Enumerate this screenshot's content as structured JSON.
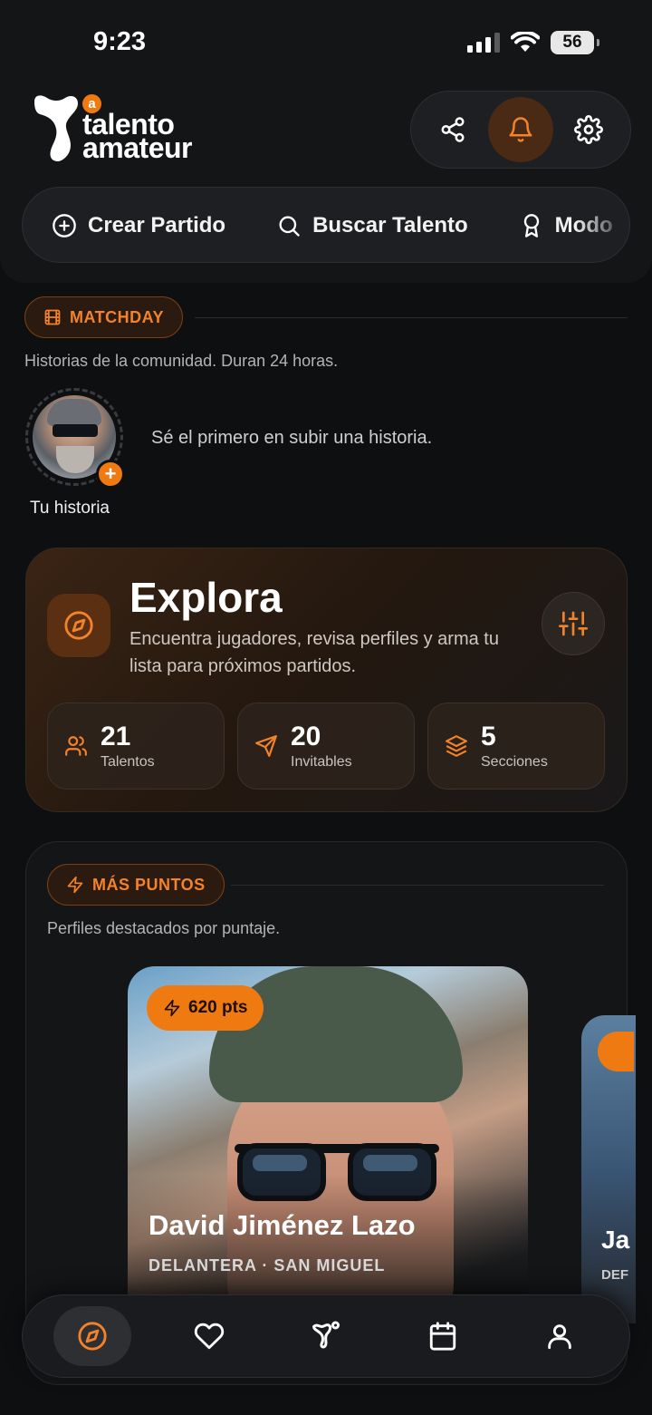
{
  "status_bar": {
    "time": "9:23",
    "battery": "56"
  },
  "brand": {
    "badge": "a",
    "line1": "talento",
    "line2": "amateur"
  },
  "colors": {
    "accent": "#f07a12",
    "background": "#0e0f11"
  },
  "header_actions": {
    "share_icon": "share-icon",
    "notifications_icon": "bell-icon",
    "settings_icon": "gear-icon"
  },
  "quick_actions": [
    {
      "label": "Crear Partido",
      "icon": "plus-circle-icon"
    },
    {
      "label": "Buscar Talento",
      "icon": "search-icon"
    },
    {
      "label": "Modo",
      "icon": "award-icon"
    }
  ],
  "matchday": {
    "pill": "MATCHDAY",
    "subtitle": "Historias de la comunidad. Duran 24 horas.",
    "my_story_label": "Tu historia",
    "empty_text": "Sé el primero en subir una historia."
  },
  "explora": {
    "title": "Explora",
    "description": "Encuentra jugadores, revisa perfiles y arma tu lista para próximos partidos.",
    "stats": [
      {
        "value": "21",
        "label": "Talentos",
        "icon": "users-icon"
      },
      {
        "value": "20",
        "label": "Invitables",
        "icon": "send-icon"
      },
      {
        "value": "5",
        "label": "Secciones",
        "icon": "layers-icon"
      }
    ]
  },
  "mas_puntos": {
    "pill": "MÁS PUNTOS",
    "subtitle": "Perfiles destacados por puntaje.",
    "profiles": [
      {
        "points": "620 pts",
        "name": "David Jiménez Lazo",
        "meta": "DELANTERA · SAN MIGUEL"
      },
      {
        "name": "Ja",
        "meta": "DEF"
      }
    ]
  },
  "bottom_nav": [
    "compass-icon",
    "heart-icon",
    "brand-icon",
    "calendar-icon",
    "user-icon"
  ]
}
